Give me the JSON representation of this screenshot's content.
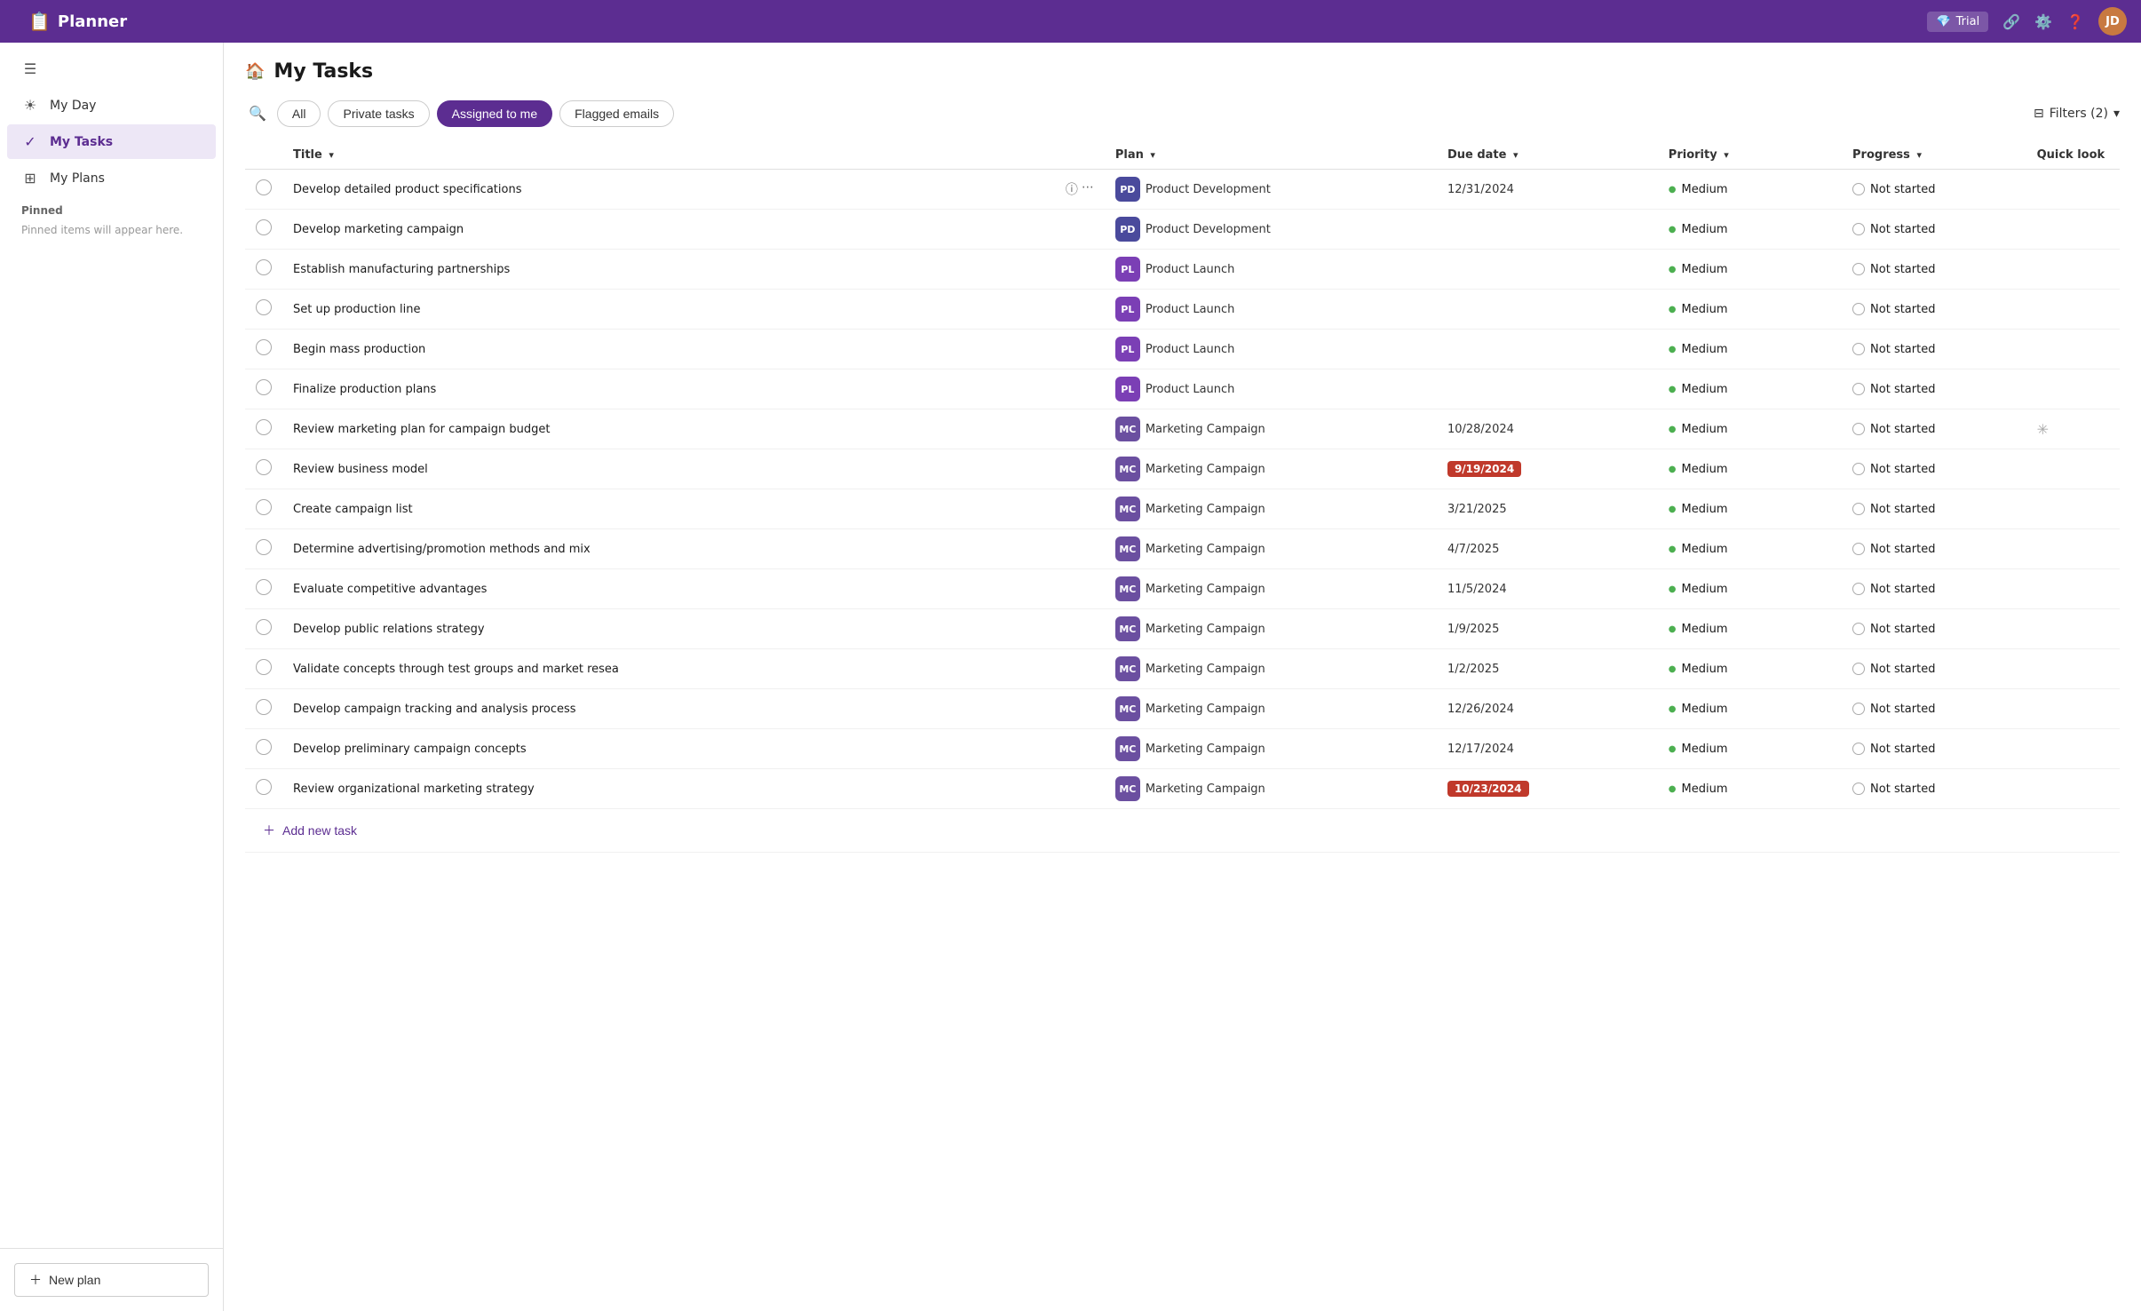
{
  "app": {
    "name": "Planner",
    "topbar_icons": [
      "trial",
      "share",
      "settings",
      "help",
      "avatar"
    ]
  },
  "sidebar": {
    "items": [
      {
        "id": "collapse",
        "icon": "☰",
        "label": ""
      },
      {
        "id": "my-day",
        "icon": "☀",
        "label": "My Day"
      },
      {
        "id": "my-tasks",
        "icon": "✓",
        "label": "My Tasks",
        "active": true
      },
      {
        "id": "my-plans",
        "icon": "⊞",
        "label": "My Plans"
      }
    ],
    "pinned_label": "Pinned",
    "pinned_hint": "Pinned items will appear here.",
    "new_plan_label": "New plan"
  },
  "header": {
    "title": "My Tasks",
    "icon": "🏠"
  },
  "filters": {
    "search_placeholder": "Search",
    "tabs": [
      {
        "id": "all",
        "label": "All",
        "active": false
      },
      {
        "id": "private",
        "label": "Private tasks",
        "active": false
      },
      {
        "id": "assigned",
        "label": "Assigned to me",
        "active": true
      },
      {
        "id": "flagged",
        "label": "Flagged emails",
        "active": false
      }
    ],
    "filter_label": "Filters (2)",
    "filter_icon": "⊟"
  },
  "table": {
    "columns": [
      {
        "id": "title",
        "label": "Title",
        "sortable": true
      },
      {
        "id": "plan",
        "label": "Plan",
        "sortable": true
      },
      {
        "id": "due_date",
        "label": "Due date",
        "sortable": true
      },
      {
        "id": "priority",
        "label": "Priority",
        "sortable": true
      },
      {
        "id": "progress",
        "label": "Progress",
        "sortable": true
      },
      {
        "id": "quick_look",
        "label": "Quick look",
        "sortable": false
      }
    ],
    "rows": [
      {
        "id": 1,
        "title": "Develop detailed product specifications",
        "plan_code": "PD",
        "plan": "Product Development",
        "plan_class": "plan-pd",
        "due_date": "12/31/2024",
        "due_overdue": false,
        "priority": "Medium",
        "progress": "Not started",
        "has_quick_look": false,
        "hovered": true
      },
      {
        "id": 2,
        "title": "Develop marketing campaign",
        "plan_code": "PD",
        "plan": "Product Development",
        "plan_class": "plan-pd",
        "due_date": "",
        "due_overdue": false,
        "priority": "Medium",
        "progress": "Not started",
        "has_quick_look": false
      },
      {
        "id": 3,
        "title": "Establish manufacturing partnerships",
        "plan_code": "PL",
        "plan": "Product Launch",
        "plan_class": "plan-pl",
        "due_date": "",
        "due_overdue": false,
        "priority": "Medium",
        "progress": "Not started",
        "has_quick_look": false
      },
      {
        "id": 4,
        "title": "Set up production line",
        "plan_code": "PL",
        "plan": "Product Launch",
        "plan_class": "plan-pl",
        "due_date": "",
        "due_overdue": false,
        "priority": "Medium",
        "progress": "Not started",
        "has_quick_look": false
      },
      {
        "id": 5,
        "title": "Begin mass production",
        "plan_code": "PL",
        "plan": "Product Launch",
        "plan_class": "plan-pl",
        "due_date": "",
        "due_overdue": false,
        "priority": "Medium",
        "progress": "Not started",
        "has_quick_look": false
      },
      {
        "id": 6,
        "title": "Finalize production plans",
        "plan_code": "PL",
        "plan": "Product Launch",
        "plan_class": "plan-pl",
        "due_date": "",
        "due_overdue": false,
        "priority": "Medium",
        "progress": "Not started",
        "has_quick_look": false
      },
      {
        "id": 7,
        "title": "Review marketing plan for campaign budget",
        "plan_code": "MC",
        "plan": "Marketing Campaign",
        "plan_class": "plan-mc",
        "due_date": "10/28/2024",
        "due_overdue": false,
        "priority": "Medium",
        "progress": "Not started",
        "has_quick_look": true
      },
      {
        "id": 8,
        "title": "Review business model",
        "plan_code": "MC",
        "plan": "Marketing Campaign",
        "plan_class": "plan-mc",
        "due_date": "9/19/2024",
        "due_overdue": true,
        "priority": "Medium",
        "progress": "Not started",
        "has_quick_look": false
      },
      {
        "id": 9,
        "title": "Create campaign list",
        "plan_code": "MC",
        "plan": "Marketing Campaign",
        "plan_class": "plan-mc",
        "due_date": "3/21/2025",
        "due_overdue": false,
        "priority": "Medium",
        "progress": "Not started",
        "has_quick_look": false
      },
      {
        "id": 10,
        "title": "Determine advertising/promotion methods and mix",
        "plan_code": "MC",
        "plan": "Marketing Campaign",
        "plan_class": "plan-mc",
        "due_date": "4/7/2025",
        "due_overdue": false,
        "priority": "Medium",
        "progress": "Not started",
        "has_quick_look": false
      },
      {
        "id": 11,
        "title": "Evaluate competitive advantages",
        "plan_code": "MC",
        "plan": "Marketing Campaign",
        "plan_class": "plan-mc",
        "due_date": "11/5/2024",
        "due_overdue": false,
        "priority": "Medium",
        "progress": "Not started",
        "has_quick_look": false
      },
      {
        "id": 12,
        "title": "Develop public relations strategy",
        "plan_code": "MC",
        "plan": "Marketing Campaign",
        "plan_class": "plan-mc",
        "due_date": "1/9/2025",
        "due_overdue": false,
        "priority": "Medium",
        "progress": "Not started",
        "has_quick_look": false
      },
      {
        "id": 13,
        "title": "Validate concepts through test groups and market resea",
        "plan_code": "MC",
        "plan": "Marketing Campaign",
        "plan_class": "plan-mc",
        "due_date": "1/2/2025",
        "due_overdue": false,
        "priority": "Medium",
        "progress": "Not started",
        "has_quick_look": false
      },
      {
        "id": 14,
        "title": "Develop campaign tracking and analysis process",
        "plan_code": "MC",
        "plan": "Marketing Campaign",
        "plan_class": "plan-mc",
        "due_date": "12/26/2024",
        "due_overdue": false,
        "priority": "Medium",
        "progress": "Not started",
        "has_quick_look": false
      },
      {
        "id": 15,
        "title": "Develop preliminary campaign concepts",
        "plan_code": "MC",
        "plan": "Marketing Campaign",
        "plan_class": "plan-mc",
        "due_date": "12/17/2024",
        "due_overdue": false,
        "priority": "Medium",
        "progress": "Not started",
        "has_quick_look": false
      },
      {
        "id": 16,
        "title": "Review organizational marketing strategy",
        "plan_code": "MC",
        "plan": "Marketing Campaign",
        "plan_class": "plan-mc",
        "due_date": "10/23/2024",
        "due_overdue": true,
        "priority": "Medium",
        "progress": "Not started",
        "has_quick_look": false
      }
    ],
    "add_task_label": "Add new task"
  },
  "topbar": {
    "trial_label": "Trial",
    "avatar_initials": "JD"
  }
}
